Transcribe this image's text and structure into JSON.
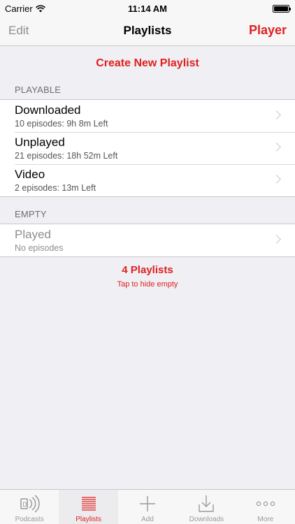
{
  "status_bar": {
    "carrier": "Carrier",
    "time": "11:14 AM"
  },
  "nav": {
    "edit_label": "Edit",
    "title": "Playlists",
    "player_label": "Player"
  },
  "create_label": "Create New Playlist",
  "sections": [
    {
      "header": "PLAYABLE",
      "items": [
        {
          "title": "Downloaded",
          "subtitle": "10 episodes: 9h 8m Left"
        },
        {
          "title": "Unplayed",
          "subtitle": "21 episodes: 18h 52m Left"
        },
        {
          "title": "Video",
          "subtitle": "2 episodes: 13m Left"
        }
      ]
    },
    {
      "header": "EMPTY",
      "items": [
        {
          "title": "Played",
          "subtitle": "No episodes"
        }
      ]
    }
  ],
  "summary": {
    "count_label": "4 Playlists",
    "hint": "Tap to hide empty"
  },
  "tabs": [
    {
      "label": "Podcasts",
      "icon": "podcasts-icon",
      "active": false
    },
    {
      "label": "Playlists",
      "icon": "playlists-icon",
      "active": true
    },
    {
      "label": "Add",
      "icon": "add-icon",
      "active": false
    },
    {
      "label": "Downloads",
      "icon": "downloads-icon",
      "active": false
    },
    {
      "label": "More",
      "icon": "more-icon",
      "active": false
    }
  ],
  "colors": {
    "accent": "#e0201f",
    "background": "#efeff4"
  }
}
